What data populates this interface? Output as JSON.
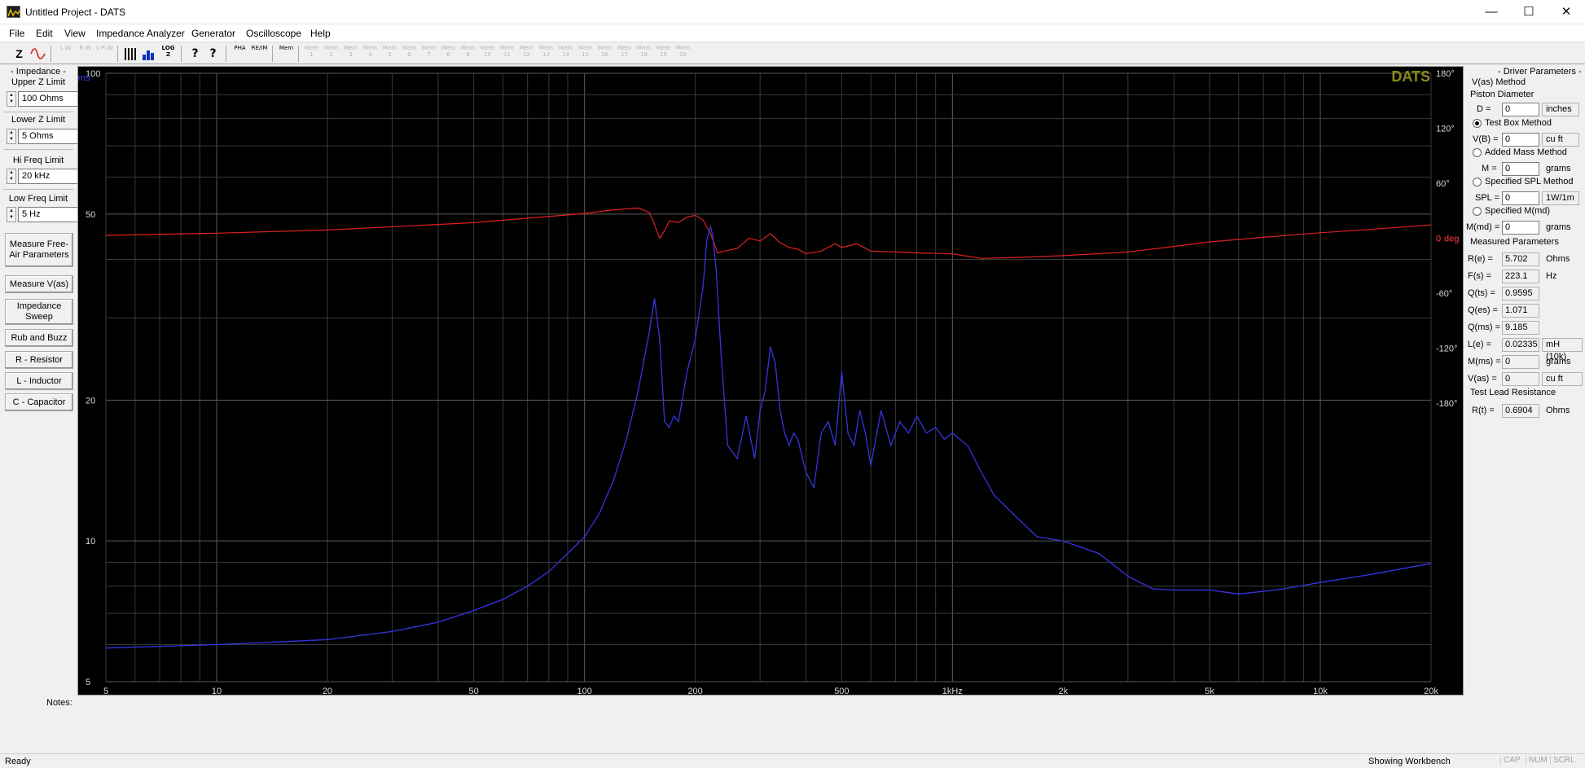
{
  "window": {
    "title": "Untitled Project - DATS"
  },
  "menu": [
    "File",
    "Edit",
    "View",
    "Impedance Analyzer",
    "Generator",
    "Oscilloscope",
    "Help"
  ],
  "toolbar": {
    "buttons": [
      "Z",
      "~",
      "L IN",
      "R IN",
      "L-R IN",
      "",
      "",
      "",
      "?",
      "?",
      "PHA",
      "RE/IM",
      "Mem"
    ],
    "mem_slots": [
      "Mem 1",
      "Mem 2",
      "Mem 3",
      "Mem 4",
      "Mem 5",
      "Mem 6",
      "Mem 7",
      "Mem 8",
      "Mem 9",
      "Mem 10",
      "Mem 11",
      "Mem 12",
      "Mem 13",
      "Mem 14",
      "Mem 15",
      "Mem 16",
      "Mem 17",
      "Mem 18",
      "Mem 19",
      "Mem 20"
    ]
  },
  "left_panel": {
    "group_title": "- Impedance -",
    "upper_z": {
      "label": "Upper Z Limit",
      "value": "100 Ohms"
    },
    "lower_z": {
      "label": "Lower Z Limit",
      "value": "5 Ohms"
    },
    "hi_freq": {
      "label": "Hi Freq Limit",
      "value": "20 kHz"
    },
    "low_freq": {
      "label": "Low Freq Limit",
      "value": "5 Hz"
    },
    "buttons": {
      "measure_free_air": "Measure Free-Air Parameters",
      "measure_vas": "Measure V(as)",
      "impedance_sweep": "Impedance Sweep",
      "rub_buzz": "Rub and Buzz",
      "resistor": "R - Resistor",
      "inductor": "L - Inductor",
      "capacitor": "C - Capacitor"
    }
  },
  "graph": {
    "logo": "DATS",
    "y_unit": "Ohms",
    "phase_unit": "deg",
    "colors": {
      "impedance": "#3535e0",
      "phase": "#e02020",
      "logo": "#8a8a18",
      "grid": "#3a3a3a",
      "grid_major": "#5a5a5a"
    }
  },
  "chart_data": {
    "type": "line",
    "x_scale": "log",
    "xlim": [
      5,
      20000
    ],
    "ylim": [
      5,
      100
    ],
    "y_scale": "log",
    "phase_lim": [
      -180,
      180
    ],
    "x_tick_labels": [
      "5",
      "10",
      "20",
      "50",
      "100",
      "200",
      "500",
      "1kHz",
      "2k",
      "5k",
      "10k",
      "20k"
    ],
    "x_tick_values": [
      5,
      10,
      20,
      50,
      100,
      200,
      500,
      1000,
      2000,
      5000,
      10000,
      20000
    ],
    "y_tick_labels": [
      "5",
      "10",
      "20",
      "50",
      "100"
    ],
    "y_tick_values": [
      5,
      10,
      20,
      50,
      100
    ],
    "phase_tick_labels": [
      "180°",
      "120°",
      "60°",
      "0",
      "-60°",
      "-120°",
      "-180°"
    ],
    "phase_tick_values": [
      180,
      120,
      60,
      0,
      -60,
      -120,
      -180
    ],
    "series": [
      {
        "name": "Impedance",
        "unit": "Ohms",
        "x": [
          5,
          10,
          20,
          30,
          40,
          50,
          60,
          70,
          80,
          100,
          110,
          120,
          130,
          140,
          150,
          155,
          160,
          165,
          170,
          175,
          180,
          190,
          200,
          210,
          215,
          220,
          223,
          228,
          235,
          245,
          260,
          275,
          290,
          300,
          310,
          320,
          330,
          340,
          350,
          360,
          370,
          380,
          400,
          420,
          440,
          460,
          480,
          500,
          520,
          540,
          560,
          580,
          600,
          640,
          680,
          720,
          760,
          800,
          850,
          900,
          950,
          1000,
          1100,
          1200,
          1300,
          1500,
          1700,
          2000,
          2500,
          3000,
          3500,
          4000,
          5000,
          6000,
          7000,
          8000,
          10000,
          14000,
          20000
        ],
        "values": [
          5.9,
          6.0,
          6.15,
          6.4,
          6.7,
          7.1,
          7.5,
          8.0,
          8.6,
          10.2,
          11.5,
          13.5,
          16.5,
          21.0,
          28.0,
          33.0,
          27.0,
          18.0,
          17.5,
          18.5,
          18.0,
          23.0,
          27.0,
          35.0,
          44.0,
          47.0,
          45.0,
          38.0,
          25.0,
          16.0,
          15.0,
          18.5,
          15.0,
          19.0,
          21.0,
          26.0,
          24.0,
          19.0,
          17.0,
          16.0,
          17.0,
          16.5,
          14.0,
          13.0,
          17.0,
          18.0,
          16.0,
          23.0,
          17.0,
          16.0,
          19.0,
          17.0,
          14.5,
          19.0,
          16.0,
          18.0,
          17.0,
          18.5,
          17.0,
          17.5,
          16.5,
          17.0,
          16.0,
          14.0,
          12.5,
          11.2,
          10.2,
          10.0,
          9.4,
          8.4,
          7.9,
          7.85,
          7.85,
          7.7,
          7.8,
          7.9,
          8.15,
          8.5,
          8.95
        ]
      },
      {
        "name": "Phase",
        "unit": "deg",
        "x": [
          5,
          10,
          20,
          50,
          100,
          120,
          140,
          150,
          155,
          160,
          165,
          170,
          180,
          190,
          200,
          210,
          220,
          230,
          240,
          260,
          280,
          300,
          320,
          340,
          360,
          380,
          400,
          440,
          480,
          500,
          550,
          600,
          700,
          800,
          1000,
          1200,
          1500,
          2000,
          3000,
          4000,
          5000,
          7000,
          10000,
          14000,
          20000
        ],
        "values": [
          3.0,
          5.5,
          9.0,
          17.0,
          27.0,
          31.0,
          33.0,
          28.0,
          15.0,
          0.0,
          8.0,
          19.0,
          17.0,
          23.0,
          25.0,
          20.0,
          5.0,
          -16.0,
          -14.0,
          -11.0,
          0.0,
          -3.0,
          5.0,
          -5.0,
          -10.0,
          -12.0,
          -17.0,
          -14.0,
          -6.0,
          -10.0,
          -6.0,
          -14.0,
          -15.0,
          -16.0,
          -17.0,
          -22.0,
          -21.0,
          -19.0,
          -15.0,
          -9.0,
          -4.0,
          1.0,
          6.0,
          10.0,
          14.5
        ]
      }
    ]
  },
  "right_panel": {
    "title": "- Driver Parameters -",
    "vas_method": "V(as) Method",
    "piston_diameter": "Piston Diameter",
    "d": {
      "label": "D =",
      "value": "0",
      "unit": "inches"
    },
    "test_box": "Test Box Method",
    "vb": {
      "label": "V(B) =",
      "value": "0",
      "unit": "cu ft"
    },
    "added_mass": "Added Mass Method",
    "m": {
      "label": "M =",
      "value": "0",
      "unit": "grams"
    },
    "specified_spl": "Specified SPL Method",
    "spl": {
      "label": "SPL =",
      "value": "0",
      "unit": "1W/1m"
    },
    "specified_mmd": "Specified M(md)",
    "mmd": {
      "label": "M(md) =",
      "value": "0",
      "unit": "grams"
    },
    "measured_title": "Measured Parameters",
    "measured": [
      {
        "label": "R(e) =",
        "value": "5.702",
        "unit": "Ohms"
      },
      {
        "label": "F(s) =",
        "value": "223.1",
        "unit": "Hz"
      },
      {
        "label": "Q(ts) =",
        "value": "0.9595",
        "unit": ""
      },
      {
        "label": "Q(es) =",
        "value": "1.071",
        "unit": ""
      },
      {
        "label": "Q(ms) =",
        "value": "9.185",
        "unit": ""
      },
      {
        "label": "L(e) =",
        "value": "0.02335",
        "unit": "mH (10k)"
      },
      {
        "label": "M(ms) =",
        "value": "0",
        "unit": "grams"
      },
      {
        "label": "V(as) =",
        "value": "0",
        "unit": "cu ft"
      }
    ],
    "test_lead_title": "Test Lead Resistance",
    "rt": {
      "label": "R(t) =",
      "value": "0.6904",
      "unit": "Ohms"
    }
  },
  "notes_label": "Notes:",
  "status": {
    "left": "Ready",
    "right": "Showing Workbench",
    "indicators": [
      "CAP",
      "NUM",
      "SCRL"
    ]
  }
}
